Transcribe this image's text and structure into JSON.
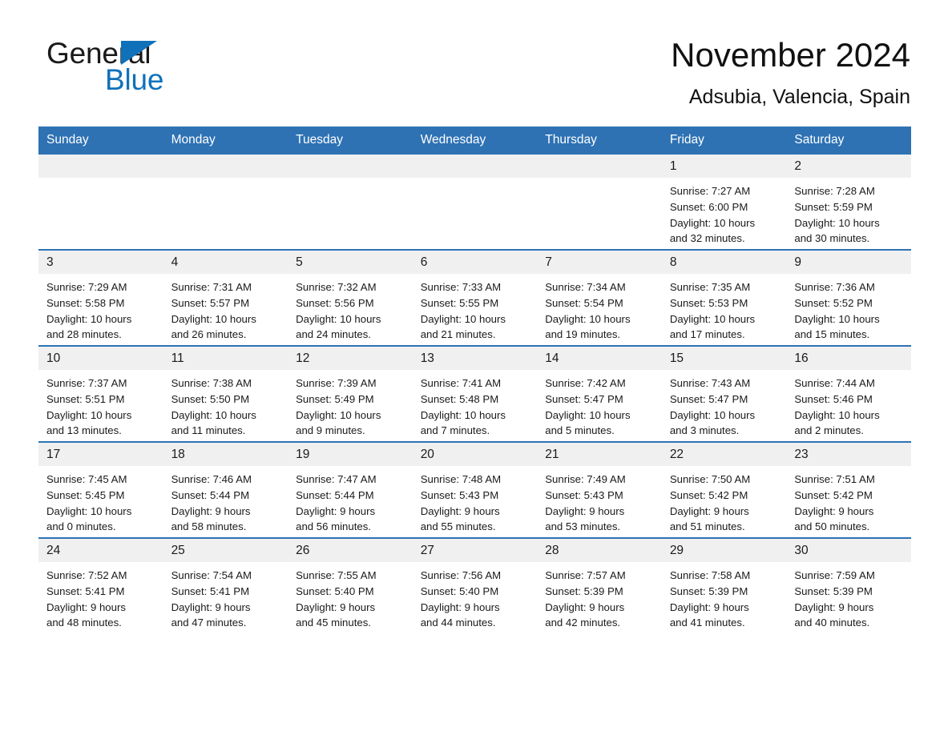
{
  "brand": {
    "name_part1": "General",
    "name_part2": "Blue",
    "accent_color": "#1071bb"
  },
  "header": {
    "month_title": "November 2024",
    "location": "Adsubia, Valencia, Spain",
    "header_bg_color": "#2e72b4"
  },
  "weekday_headers": [
    "Sunday",
    "Monday",
    "Tuesday",
    "Wednesday",
    "Thursday",
    "Friday",
    "Saturday"
  ],
  "weeks": [
    [
      {
        "day": "",
        "lines": []
      },
      {
        "day": "",
        "lines": []
      },
      {
        "day": "",
        "lines": []
      },
      {
        "day": "",
        "lines": []
      },
      {
        "day": "",
        "lines": []
      },
      {
        "day": "1",
        "lines": [
          "Sunrise: 7:27 AM",
          "Sunset: 6:00 PM",
          "Daylight: 10 hours",
          "and 32 minutes."
        ]
      },
      {
        "day": "2",
        "lines": [
          "Sunrise: 7:28 AM",
          "Sunset: 5:59 PM",
          "Daylight: 10 hours",
          "and 30 minutes."
        ]
      }
    ],
    [
      {
        "day": "3",
        "lines": [
          "Sunrise: 7:29 AM",
          "Sunset: 5:58 PM",
          "Daylight: 10 hours",
          "and 28 minutes."
        ]
      },
      {
        "day": "4",
        "lines": [
          "Sunrise: 7:31 AM",
          "Sunset: 5:57 PM",
          "Daylight: 10 hours",
          "and 26 minutes."
        ]
      },
      {
        "day": "5",
        "lines": [
          "Sunrise: 7:32 AM",
          "Sunset: 5:56 PM",
          "Daylight: 10 hours",
          "and 24 minutes."
        ]
      },
      {
        "day": "6",
        "lines": [
          "Sunrise: 7:33 AM",
          "Sunset: 5:55 PM",
          "Daylight: 10 hours",
          "and 21 minutes."
        ]
      },
      {
        "day": "7",
        "lines": [
          "Sunrise: 7:34 AM",
          "Sunset: 5:54 PM",
          "Daylight: 10 hours",
          "and 19 minutes."
        ]
      },
      {
        "day": "8",
        "lines": [
          "Sunrise: 7:35 AM",
          "Sunset: 5:53 PM",
          "Daylight: 10 hours",
          "and 17 minutes."
        ]
      },
      {
        "day": "9",
        "lines": [
          "Sunrise: 7:36 AM",
          "Sunset: 5:52 PM",
          "Daylight: 10 hours",
          "and 15 minutes."
        ]
      }
    ],
    [
      {
        "day": "10",
        "lines": [
          "Sunrise: 7:37 AM",
          "Sunset: 5:51 PM",
          "Daylight: 10 hours",
          "and 13 minutes."
        ]
      },
      {
        "day": "11",
        "lines": [
          "Sunrise: 7:38 AM",
          "Sunset: 5:50 PM",
          "Daylight: 10 hours",
          "and 11 minutes."
        ]
      },
      {
        "day": "12",
        "lines": [
          "Sunrise: 7:39 AM",
          "Sunset: 5:49 PM",
          "Daylight: 10 hours",
          "and 9 minutes."
        ]
      },
      {
        "day": "13",
        "lines": [
          "Sunrise: 7:41 AM",
          "Sunset: 5:48 PM",
          "Daylight: 10 hours",
          "and 7 minutes."
        ]
      },
      {
        "day": "14",
        "lines": [
          "Sunrise: 7:42 AM",
          "Sunset: 5:47 PM",
          "Daylight: 10 hours",
          "and 5 minutes."
        ]
      },
      {
        "day": "15",
        "lines": [
          "Sunrise: 7:43 AM",
          "Sunset: 5:47 PM",
          "Daylight: 10 hours",
          "and 3 minutes."
        ]
      },
      {
        "day": "16",
        "lines": [
          "Sunrise: 7:44 AM",
          "Sunset: 5:46 PM",
          "Daylight: 10 hours",
          "and 2 minutes."
        ]
      }
    ],
    [
      {
        "day": "17",
        "lines": [
          "Sunrise: 7:45 AM",
          "Sunset: 5:45 PM",
          "Daylight: 10 hours",
          "and 0 minutes."
        ]
      },
      {
        "day": "18",
        "lines": [
          "Sunrise: 7:46 AM",
          "Sunset: 5:44 PM",
          "Daylight: 9 hours",
          "and 58 minutes."
        ]
      },
      {
        "day": "19",
        "lines": [
          "Sunrise: 7:47 AM",
          "Sunset: 5:44 PM",
          "Daylight: 9 hours",
          "and 56 minutes."
        ]
      },
      {
        "day": "20",
        "lines": [
          "Sunrise: 7:48 AM",
          "Sunset: 5:43 PM",
          "Daylight: 9 hours",
          "and 55 minutes."
        ]
      },
      {
        "day": "21",
        "lines": [
          "Sunrise: 7:49 AM",
          "Sunset: 5:43 PM",
          "Daylight: 9 hours",
          "and 53 minutes."
        ]
      },
      {
        "day": "22",
        "lines": [
          "Sunrise: 7:50 AM",
          "Sunset: 5:42 PM",
          "Daylight: 9 hours",
          "and 51 minutes."
        ]
      },
      {
        "day": "23",
        "lines": [
          "Sunrise: 7:51 AM",
          "Sunset: 5:42 PM",
          "Daylight: 9 hours",
          "and 50 minutes."
        ]
      }
    ],
    [
      {
        "day": "24",
        "lines": [
          "Sunrise: 7:52 AM",
          "Sunset: 5:41 PM",
          "Daylight: 9 hours",
          "and 48 minutes."
        ]
      },
      {
        "day": "25",
        "lines": [
          "Sunrise: 7:54 AM",
          "Sunset: 5:41 PM",
          "Daylight: 9 hours",
          "and 47 minutes."
        ]
      },
      {
        "day": "26",
        "lines": [
          "Sunrise: 7:55 AM",
          "Sunset: 5:40 PM",
          "Daylight: 9 hours",
          "and 45 minutes."
        ]
      },
      {
        "day": "27",
        "lines": [
          "Sunrise: 7:56 AM",
          "Sunset: 5:40 PM",
          "Daylight: 9 hours",
          "and 44 minutes."
        ]
      },
      {
        "day": "28",
        "lines": [
          "Sunrise: 7:57 AM",
          "Sunset: 5:39 PM",
          "Daylight: 9 hours",
          "and 42 minutes."
        ]
      },
      {
        "day": "29",
        "lines": [
          "Sunrise: 7:58 AM",
          "Sunset: 5:39 PM",
          "Daylight: 9 hours",
          "and 41 minutes."
        ]
      },
      {
        "day": "30",
        "lines": [
          "Sunrise: 7:59 AM",
          "Sunset: 5:39 PM",
          "Daylight: 9 hours",
          "and 40 minutes."
        ]
      }
    ]
  ]
}
